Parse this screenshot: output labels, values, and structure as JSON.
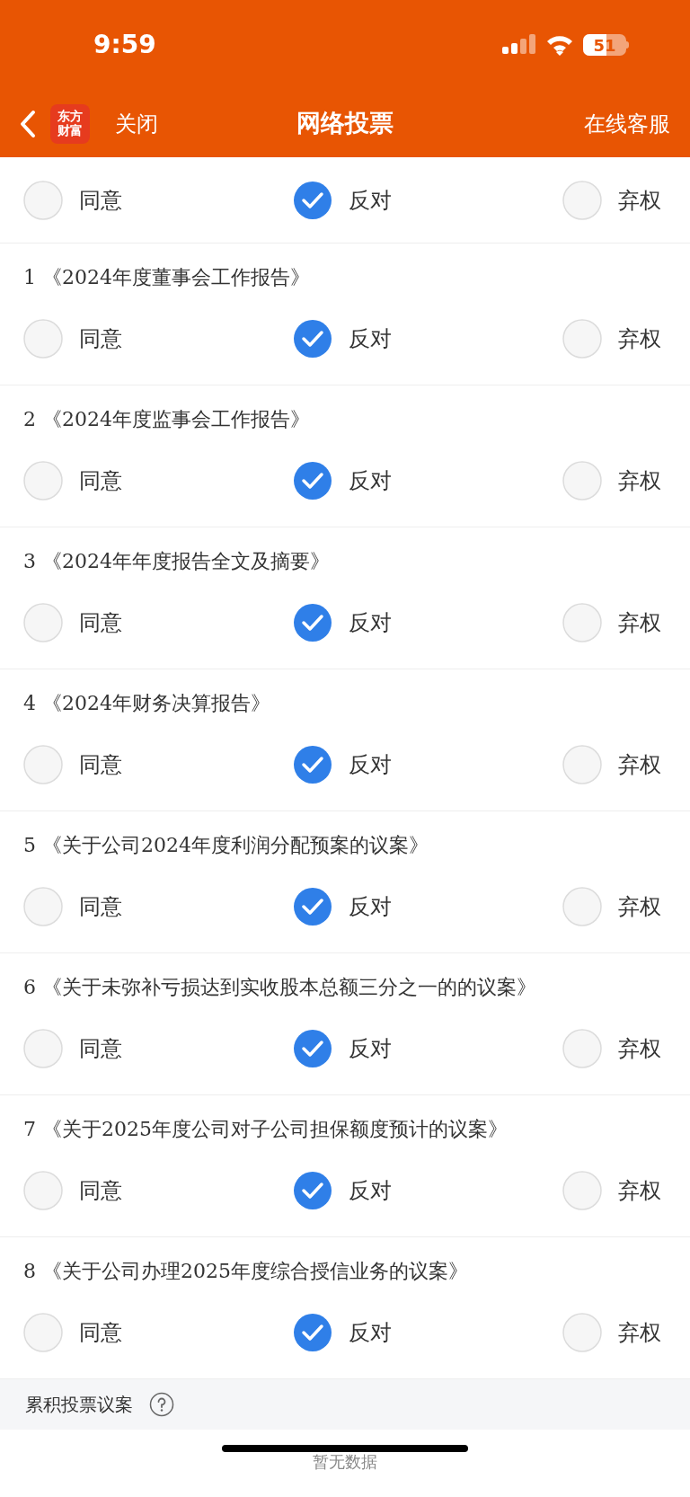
{
  "status_bar": {
    "time": "9:59",
    "battery": "51"
  },
  "nav": {
    "logo": "东方财富",
    "close": "关闭",
    "title": "网络投票",
    "service": "在线客服"
  },
  "partial_item": {
    "options": [
      {
        "label": "同意",
        "selected": false
      },
      {
        "label": "反对",
        "selected": true
      },
      {
        "label": "弃权",
        "selected": false
      }
    ]
  },
  "items": [
    {
      "number": "1",
      "title": "《2024年度董事会工作报告》",
      "options": [
        {
          "label": "同意",
          "selected": false
        },
        {
          "label": "反对",
          "selected": true
        },
        {
          "label": "弃权",
          "selected": false
        }
      ]
    },
    {
      "number": "2",
      "title": "《2024年度监事会工作报告》",
      "options": [
        {
          "label": "同意",
          "selected": false
        },
        {
          "label": "反对",
          "selected": true
        },
        {
          "label": "弃权",
          "selected": false
        }
      ]
    },
    {
      "number": "3",
      "title": "《2024年年度报告全文及摘要》",
      "options": [
        {
          "label": "同意",
          "selected": false
        },
        {
          "label": "反对",
          "selected": true
        },
        {
          "label": "弃权",
          "selected": false
        }
      ]
    },
    {
      "number": "4",
      "title": "《2024年财务决算报告》",
      "options": [
        {
          "label": "同意",
          "selected": false
        },
        {
          "label": "反对",
          "selected": true
        },
        {
          "label": "弃权",
          "selected": false
        }
      ]
    },
    {
      "number": "5",
      "title": "《关于公司2024年度利润分配预案的议案》",
      "options": [
        {
          "label": "同意",
          "selected": false
        },
        {
          "label": "反对",
          "selected": true
        },
        {
          "label": "弃权",
          "selected": false
        }
      ]
    },
    {
      "number": "6",
      "title": "《关于未弥补亏损达到实收股本总额三分之一的的议案》",
      "options": [
        {
          "label": "同意",
          "selected": false
        },
        {
          "label": "反对",
          "selected": true
        },
        {
          "label": "弃权",
          "selected": false
        }
      ]
    },
    {
      "number": "7",
      "title": "《关于2025年度公司对子公司担保额度预计的议案》",
      "options": [
        {
          "label": "同意",
          "selected": false
        },
        {
          "label": "反对",
          "selected": true
        },
        {
          "label": "弃权",
          "selected": false
        }
      ]
    },
    {
      "number": "8",
      "title": "《关于公司办理2025年度综合授信业务的议案》",
      "options": [
        {
          "label": "同意",
          "selected": false
        },
        {
          "label": "反对",
          "selected": true
        },
        {
          "label": "弃权",
          "selected": false
        }
      ]
    }
  ],
  "cumulative": {
    "title": "累积投票议案",
    "empty": "暂无数据"
  }
}
